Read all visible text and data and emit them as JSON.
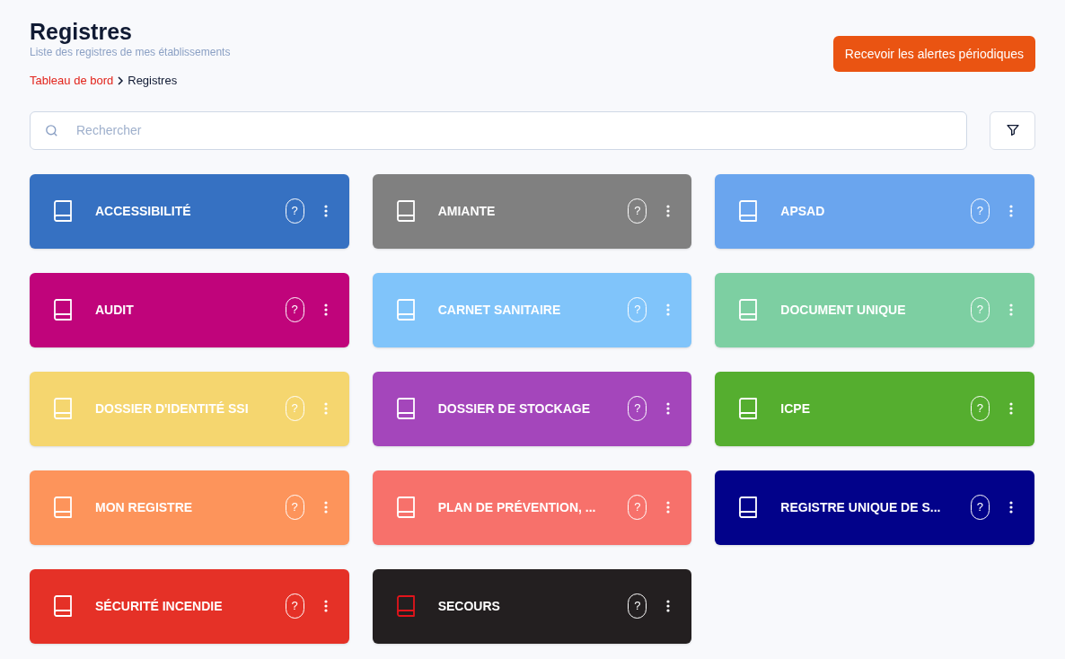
{
  "header": {
    "title": "Registres",
    "subtitle": "Liste des registres de mes établissements",
    "breadcrumb": [
      {
        "label": "Tableau de bord",
        "kind": "link"
      },
      {
        "label": "Registres",
        "kind": "current"
      }
    ],
    "action_button": "Recevoir les alertes périodiques"
  },
  "search": {
    "placeholder": "Rechercher"
  },
  "registers": [
    {
      "name": "ACCESSIBILITÉ",
      "color": "#3671c2",
      "accent_icon": false,
      "help": "?"
    },
    {
      "name": "AMIANTE",
      "color": "#808080",
      "accent_icon": false,
      "help": "?"
    },
    {
      "name": "APSAD",
      "color": "#6aa5ee",
      "accent_icon": false,
      "help": "?"
    },
    {
      "name": "AUDIT",
      "color": "#c0047b",
      "accent_icon": false,
      "help": "?"
    },
    {
      "name": "CARNET SANITAIRE",
      "color": "#80c4fa",
      "accent_icon": false,
      "help": "?"
    },
    {
      "name": "DOCUMENT UNIQUE",
      "color": "#7dcfa2",
      "accent_icon": false,
      "help": "?"
    },
    {
      "name": "DOSSIER D'IDENTITÉ SSI",
      "color": "#f5d66f",
      "accent_icon": false,
      "help": "?"
    },
    {
      "name": "DOSSIER DE STOCKAGE",
      "color": "#a446bb",
      "accent_icon": false,
      "help": "?"
    },
    {
      "name": "ICPE",
      "color": "#55ae2f",
      "accent_icon": false,
      "help": "?"
    },
    {
      "name": "MON REGISTRE",
      "color": "#fd945b",
      "accent_icon": false,
      "help": "?"
    },
    {
      "name": "PLAN DE PRÉVENTION, ...",
      "color": "#f7716b",
      "accent_icon": false,
      "help": "?"
    },
    {
      "name": "REGISTRE UNIQUE DE S...",
      "color": "#02028a",
      "accent_icon": false,
      "help": "?"
    },
    {
      "name": "SÉCURITÉ INCENDIE",
      "color": "#e53127",
      "accent_icon": false,
      "help": "?"
    },
    {
      "name": "SECOURS",
      "color": "#231f20",
      "accent_icon": true,
      "help": "?"
    }
  ]
}
